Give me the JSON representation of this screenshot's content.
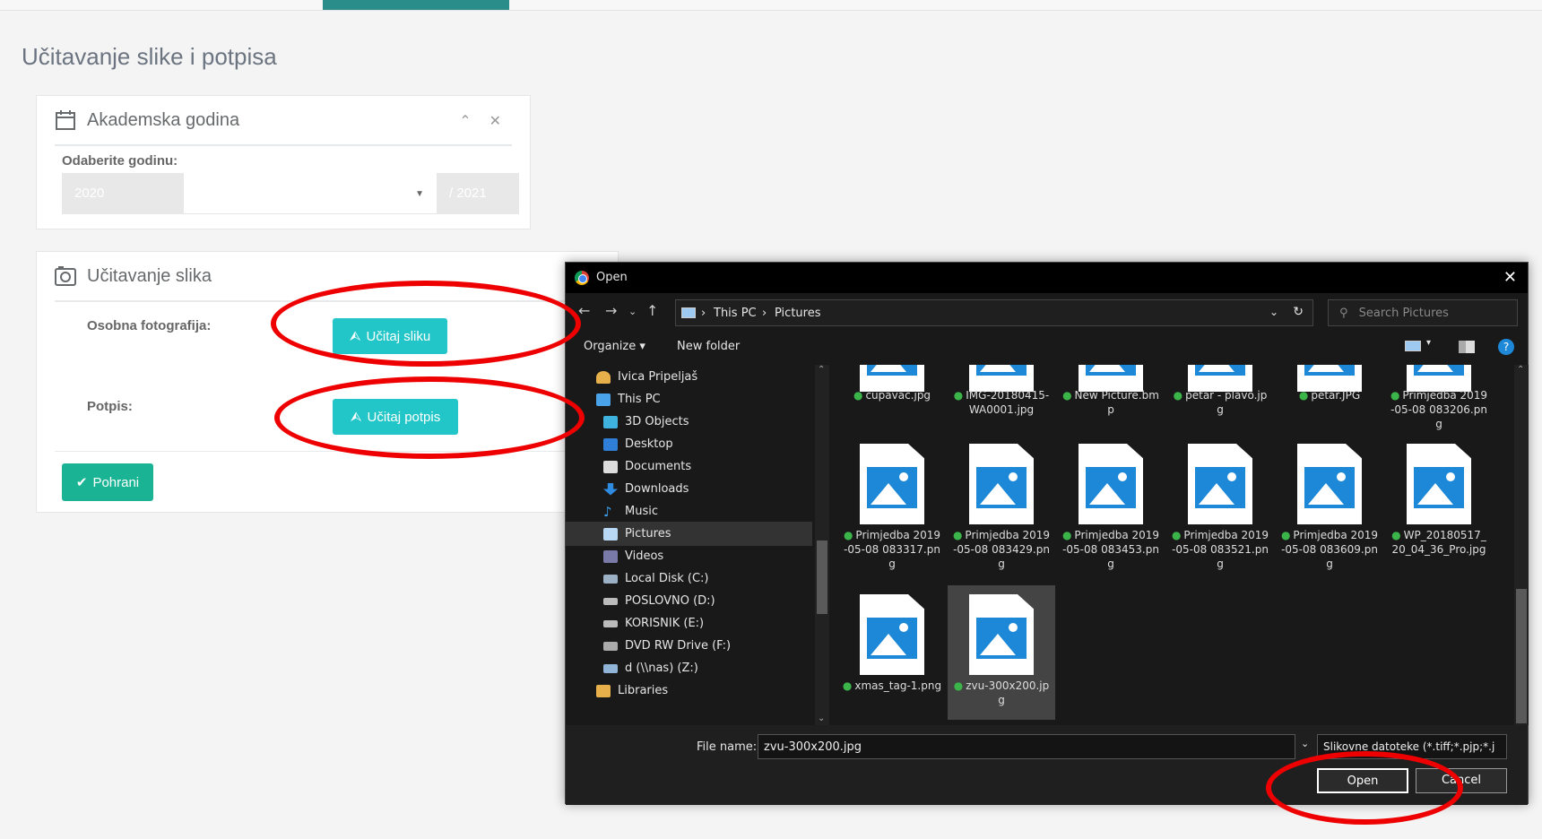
{
  "page": {
    "title": "Učitavanje slike i potpisa"
  },
  "year_panel": {
    "title": "Akademska godina",
    "label": "Odaberite godinu:",
    "year_start": "2020",
    "year_end": "/ 2021"
  },
  "upload_panel": {
    "title": "Učitavanje slika",
    "photo_label": "Osobna fotografija:",
    "photo_button": "Učitaj sliku",
    "signature_label": "Potpis:",
    "signature_button": "Učitaj potpis",
    "save_button": "Pohrani"
  },
  "dialog": {
    "title": "Open",
    "breadcrumb": [
      "This PC",
      "Pictures"
    ],
    "search_placeholder": "Search Pictures",
    "organize": "Organize",
    "new_folder": "New folder",
    "nav_items": [
      {
        "label": "Ivica Pripeljaš",
        "icon": "user-folder-icon"
      },
      {
        "label": "This PC",
        "icon": "computer-icon"
      },
      {
        "label": "3D Objects",
        "icon": "3d-objects-icon"
      },
      {
        "label": "Desktop",
        "icon": "desktop-icon"
      },
      {
        "label": "Documents",
        "icon": "documents-icon"
      },
      {
        "label": "Downloads",
        "icon": "downloads-icon"
      },
      {
        "label": "Music",
        "icon": "music-icon"
      },
      {
        "label": "Pictures",
        "icon": "pictures-icon"
      },
      {
        "label": "Videos",
        "icon": "videos-icon"
      },
      {
        "label": "Local Disk (C:)",
        "icon": "drive-icon"
      },
      {
        "label": "POSLOVNO (D:)",
        "icon": "drive-icon"
      },
      {
        "label": "KORISNIK (E:)",
        "icon": "drive-icon"
      },
      {
        "label": "DVD RW Drive (F:)",
        "icon": "dvd-drive-icon"
      },
      {
        "label": "d (\\\\nas) (Z:)",
        "icon": "network-drive-icon"
      },
      {
        "label": "Libraries",
        "icon": "libraries-icon"
      }
    ],
    "files": [
      {
        "name": "cupavac.jpg"
      },
      {
        "name": "IMG-20180415-WA0001.jpg"
      },
      {
        "name": "New Picture.bmp"
      },
      {
        "name": "petar - plavo.jpg"
      },
      {
        "name": "petar.JPG"
      },
      {
        "name": "Primjedba 2019-05-08 083206.png"
      },
      {
        "name": "Primjedba 2019-05-08 083317.png"
      },
      {
        "name": "Primjedba 2019-05-08 083429.png"
      },
      {
        "name": "Primjedba 2019-05-08 083453.png"
      },
      {
        "name": "Primjedba 2019-05-08 083521.png"
      },
      {
        "name": "Primjedba 2019-05-08 083609.png"
      },
      {
        "name": "WP_20180517_20_04_36_Pro.jpg"
      },
      {
        "name": "xmas_tag-1.png"
      },
      {
        "name": "zvu-300x200.jpg"
      }
    ],
    "file_name_label": "File name:",
    "file_name_value": "zvu-300x200.jpg",
    "file_type": "Slikovne datoteke (*.tiff;*.pjp;*.j",
    "open_button": "Open",
    "cancel_button": "Cancel"
  }
}
